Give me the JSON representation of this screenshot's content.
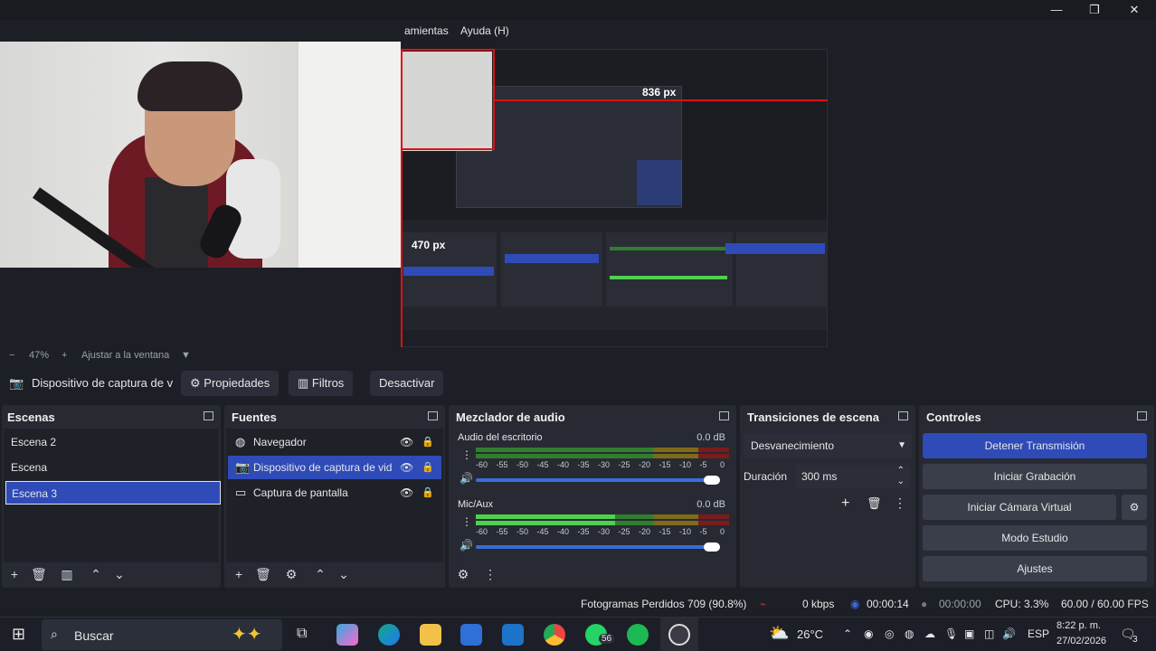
{
  "menubar": {
    "herramientas": "amientas",
    "ayuda": "Ayuda (H)"
  },
  "preview": {
    "measure_h": "836 px",
    "measure_v": "470 px"
  },
  "zoom": {
    "minus": "−",
    "value": "47%",
    "plus": "+",
    "fit": "Ajustar a la ventana"
  },
  "source_toolbar": {
    "source_name": "Dispositivo de captura de v",
    "properties": "Propiedades",
    "filters": "Filtros",
    "deactivate": "Desactivar"
  },
  "scenes": {
    "title": "Escenas",
    "items": [
      "Escena 2",
      "Escena",
      "Escena 3"
    ],
    "selected_index": 2
  },
  "sources": {
    "title": "Fuentes",
    "items": [
      {
        "label": "Navegador",
        "icon": "globe-icon"
      },
      {
        "label": "Dispositivo de captura de vid",
        "icon": "camera-icon"
      },
      {
        "label": "Captura de pantalla",
        "icon": "monitor-icon"
      }
    ],
    "selected_index": 1
  },
  "mixer": {
    "title": "Mezclador de audio",
    "channels": [
      {
        "name": "Audio del escritorio",
        "db": "0.0 dB",
        "level": 0.0,
        "volume": 1.0
      },
      {
        "name": "Mic/Aux",
        "db": "0.0 dB",
        "level": 0.55,
        "volume": 1.0
      }
    ],
    "scale": [
      "-60",
      "-55",
      "-50",
      "-45",
      "-40",
      "-35",
      "-30",
      "-25",
      "-20",
      "-15",
      "-10",
      "-5",
      "0"
    ]
  },
  "transitions": {
    "title": "Transiciones de escena",
    "selected": "Desvanecimiento",
    "duration_label": "Duración",
    "duration_value": "300 ms"
  },
  "controls": {
    "title": "Controles",
    "stop_stream": "Detener Transmisión",
    "start_recording": "Iniciar Grabación",
    "start_virtual_cam": "Iniciar Cámara Virtual",
    "studio_mode": "Modo Estudio",
    "settings": "Ajustes"
  },
  "status": {
    "dropped_frames": "Fotogramas Perdidos 709 (90.8%)",
    "kbps": "0 kbps",
    "stream_time": "00:00:14",
    "rec_time": "00:00:00",
    "cpu": "CPU: 3.3%",
    "fps": "60.00 / 60.00 FPS"
  },
  "taskbar": {
    "search_placeholder": "Buscar",
    "whatsapp_badge": "56",
    "temperature": "26°C",
    "language": "ESP",
    "time": "8:22 p. m.",
    "date": "27/02/2026",
    "notifications": "3"
  },
  "colors": {
    "accent": "#2e4bb8",
    "panel": "#272a33",
    "background": "#1d1f26",
    "recording_red": "#d11111"
  }
}
